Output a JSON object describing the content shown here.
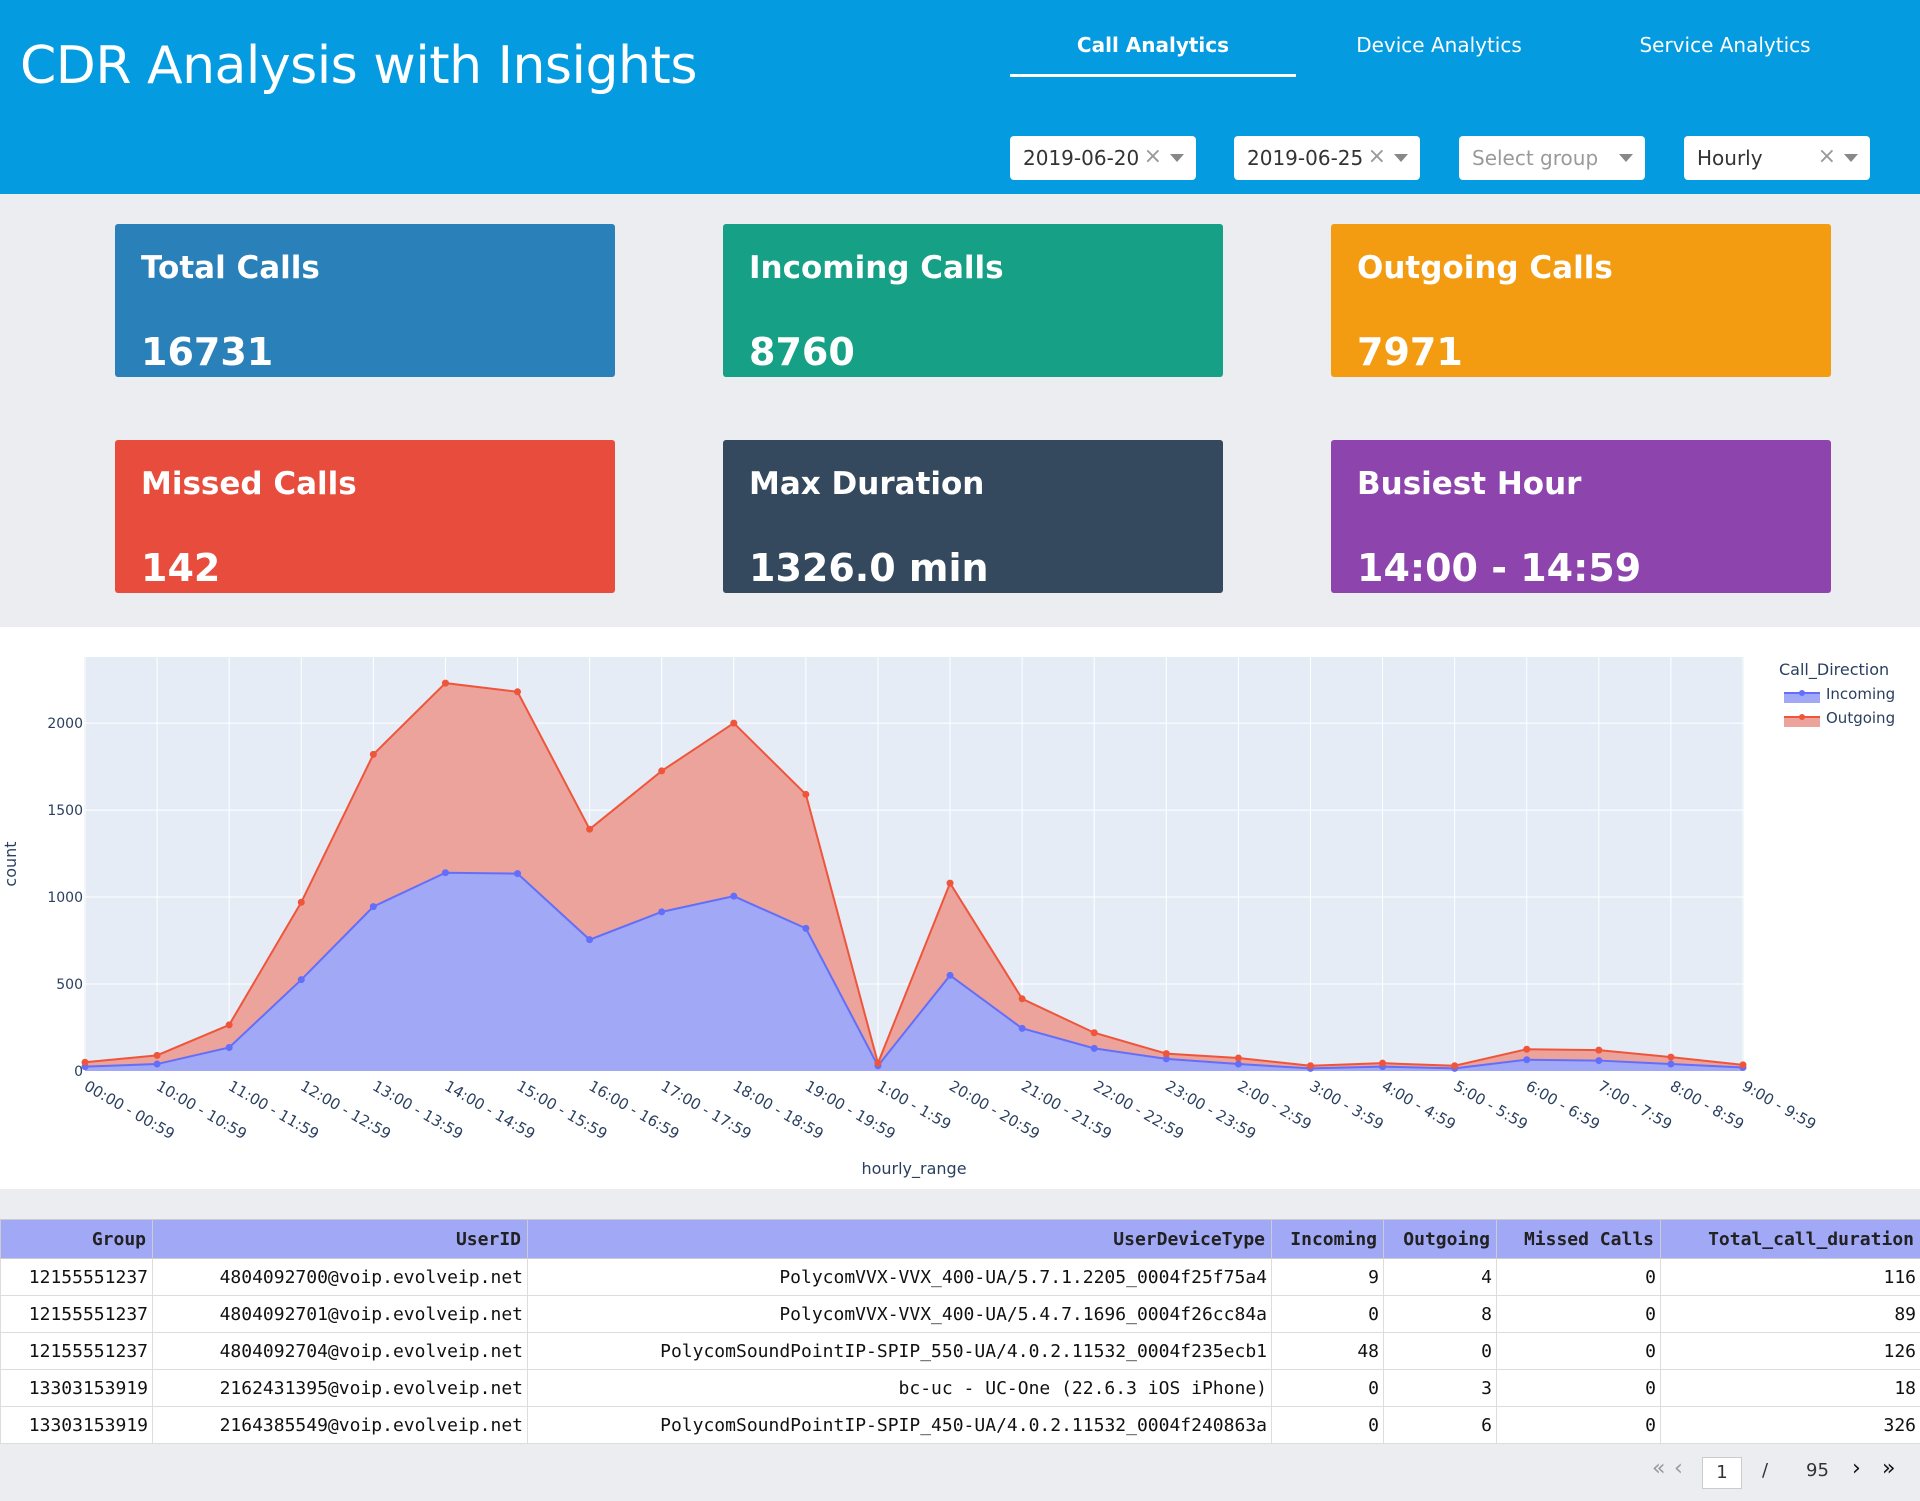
{
  "header": {
    "title": "CDR Analysis with Insights",
    "tabs": [
      {
        "label": "Call Analytics",
        "active": true
      },
      {
        "label": "Device Analytics",
        "active": false
      },
      {
        "label": "Service Analytics",
        "active": false
      }
    ],
    "filters": {
      "start_date": "2019-06-20",
      "end_date": "2019-06-25",
      "group_placeholder": "Select group",
      "granularity": "Hourly"
    }
  },
  "cards": [
    {
      "label": "Total Calls",
      "value": "16731",
      "color": "#2a80b9"
    },
    {
      "label": "Incoming Calls",
      "value": "8760",
      "color": "#16a085"
    },
    {
      "label": "Outgoing Calls",
      "value": "7971",
      "color": "#f39c12"
    },
    {
      "label": "Missed Calls",
      "value": "142",
      "color": "#e74c3c"
    },
    {
      "label": "Max Duration",
      "value": "1326.0 min",
      "color": "#34495e"
    },
    {
      "label": "Busiest Hour",
      "value": "14:00 - 14:59",
      "color": "#8e44ad"
    }
  ],
  "chart_data": {
    "type": "area",
    "stacked": true,
    "xlabel": "hourly_range",
    "ylabel": "count",
    "legend_title": "Call_Direction",
    "legend_position": "top-right",
    "ylim": [
      0,
      2380
    ],
    "yticks": [
      0,
      500,
      1000,
      1500,
      2000
    ],
    "grid": true,
    "categories": [
      "00:00 - 00:59",
      "10:00 - 10:59",
      "11:00 - 11:59",
      "12:00 - 12:59",
      "13:00 - 13:59",
      "14:00 - 14:59",
      "15:00 - 15:59",
      "16:00 - 16:59",
      "17:00 - 17:59",
      "18:00 - 18:59",
      "19:00 - 19:59",
      "1:00 - 1:59",
      "20:00 - 20:59",
      "21:00 - 21:59",
      "22:00 - 22:59",
      "23:00 - 23:59",
      "2:00 - 2:59",
      "3:00 - 3:59",
      "4:00 - 4:59",
      "5:00 - 5:59",
      "6:00 - 6:59",
      "7:00 - 7:59",
      "8:00 - 8:59",
      "9:00 - 9:59"
    ],
    "series": [
      {
        "name": "Incoming",
        "color": "#636efa",
        "fill": "#a1a9f6",
        "values": [
          25,
          40,
          135,
          525,
          945,
          1140,
          1135,
          755,
          915,
          1005,
          820,
          30,
          550,
          245,
          130,
          70,
          40,
          15,
          25,
          15,
          65,
          60,
          40,
          20
        ]
      },
      {
        "name": "Outgoing",
        "color": "#ef553b",
        "fill": "#eba39b",
        "values": [
          25,
          50,
          130,
          445,
          875,
          1090,
          1045,
          635,
          810,
          995,
          770,
          15,
          530,
          170,
          90,
          30,
          35,
          15,
          20,
          15,
          60,
          60,
          40,
          15
        ]
      }
    ]
  },
  "table": {
    "columns": [
      "Group",
      "UserID",
      "UserDeviceType",
      "Incoming",
      "Outgoing",
      "Missed Calls",
      "Total_call_duration"
    ],
    "rows": [
      [
        "12155551237",
        "4804092700@voip.evolveip.net",
        "PolycomVVX-VVX_400-UA/5.7.1.2205_0004f25f75a4",
        "9",
        "4",
        "0",
        "116"
      ],
      [
        "12155551237",
        "4804092701@voip.evolveip.net",
        "PolycomVVX-VVX_400-UA/5.4.7.1696_0004f26cc84a",
        "0",
        "8",
        "0",
        "89"
      ],
      [
        "12155551237",
        "4804092704@voip.evolveip.net",
        "PolycomSoundPointIP-SPIP_550-UA/4.0.2.11532_0004f235ecb1",
        "48",
        "0",
        "0",
        "126"
      ],
      [
        "13303153919",
        "2162431395@voip.evolveip.net",
        "bc-uc - UC-One (22.6.3 iOS iPhone)",
        "0",
        "3",
        "0",
        "18"
      ],
      [
        "13303153919",
        "2164385549@voip.evolveip.net",
        "PolycomSoundPointIP-SPIP_450-UA/4.0.2.11532_0004f240863a",
        "0",
        "6",
        "0",
        "326"
      ]
    ]
  },
  "pagination": {
    "current": "1",
    "separator": "/",
    "total": "95"
  }
}
